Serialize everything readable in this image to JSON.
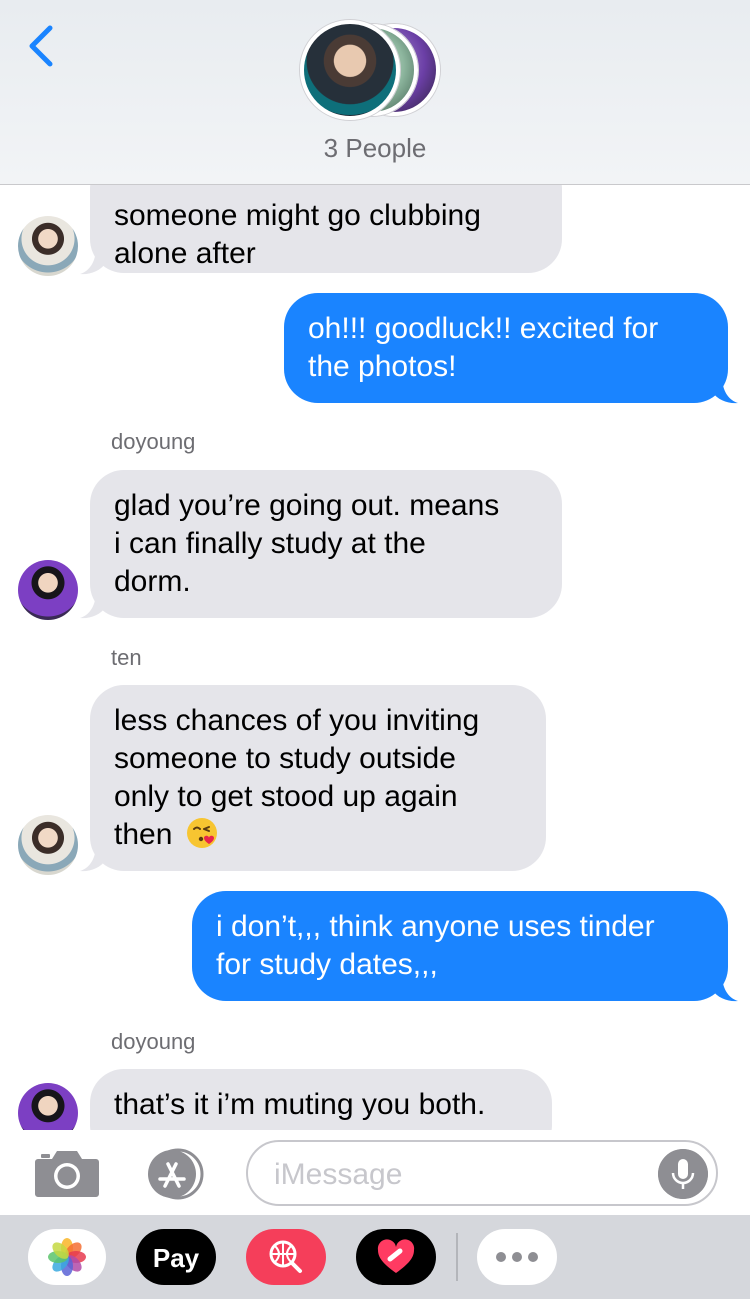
{
  "header": {
    "group_label": "3 People"
  },
  "messages": [
    {
      "from": "ten",
      "direction": "incoming",
      "lines": [
        "someone might go clubbing",
        "alone after"
      ]
    },
    {
      "direction": "outgoing",
      "lines": [
        "oh!!! goodluck!! excited for",
        "the photos!"
      ]
    },
    {
      "from": "doyoung",
      "sender_label": "doyoung",
      "direction": "incoming",
      "lines": [
        "glad you’re going out. means",
        "i can finally study at the",
        "dorm."
      ]
    },
    {
      "from": "ten",
      "sender_label": "ten",
      "direction": "incoming",
      "lines": [
        "less chances of you inviting",
        "someone to study outside",
        "only to get stood up again",
        "then"
      ],
      "trailing_emoji": "kissing-face-with-heart-emoji"
    },
    {
      "direction": "outgoing",
      "lines": [
        "i don’t,,, think anyone uses tinder",
        "for study dates,,,"
      ]
    },
    {
      "from": "doyoung",
      "sender_label": "doyoung",
      "direction": "incoming",
      "lines": [
        "that’s it i’m muting you both."
      ]
    }
  ],
  "input": {
    "placeholder": "iMessage"
  },
  "drawer": {
    "apps": [
      "photos-icon",
      "apple-pay-icon",
      "image-search-icon",
      "digital-touch-icon",
      "more-icon"
    ],
    "pay_label": "Pay",
    "pay_apple_glyph": ""
  },
  "colors": {
    "accent": "#1a84ff",
    "incoming_bubble": "#e5e5ea",
    "secondary_text": "#6d6d72"
  }
}
